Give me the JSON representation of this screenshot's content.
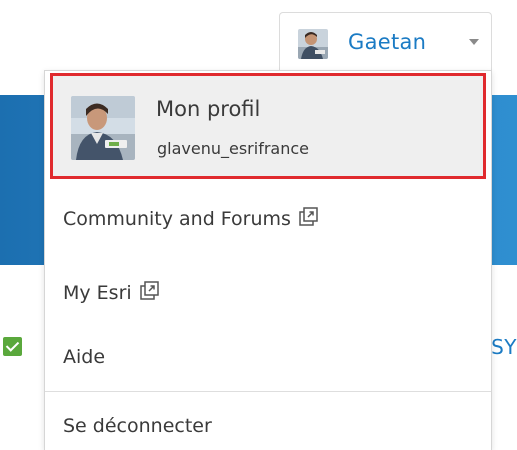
{
  "user_button": {
    "name": "Gaetan",
    "avatar_icon": "user-avatar-photo",
    "caret_icon": "caret-down-icon"
  },
  "dropdown": {
    "profile": {
      "label": "Mon profil",
      "username": "glavenu_esrifrance"
    },
    "items": [
      {
        "label": "Community and Forums",
        "icon": "external-link-icon"
      },
      {
        "label": "My Esri",
        "icon": "external-link-icon"
      },
      {
        "label": "Aide"
      }
    ],
    "logout_label": "Se déconnecter"
  },
  "background": {
    "partial_text": "SY"
  },
  "colors": {
    "accent": "#1b7bc4",
    "highlight_border": "#e02a2e",
    "banner": "#2a86c8",
    "check": "#5aa83c"
  }
}
